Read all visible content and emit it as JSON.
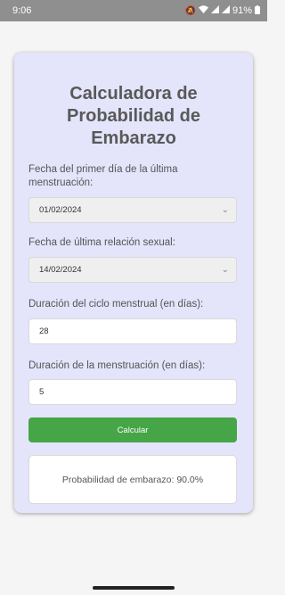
{
  "status_bar": {
    "time": "9:06",
    "battery": "91%",
    "icons": [
      "mute-icon",
      "wifi-icon",
      "signal-icon",
      "signal-icon",
      "battery-icon"
    ]
  },
  "app": {
    "title_line1": "Calculadora de",
    "title_line2": "Probabilidad de",
    "title_line3": "Embarazo",
    "last_period_label": "Fecha del primer día de la última menstruación:",
    "last_period_value": "01/02/2024",
    "last_intercourse_label": "Fecha de última relación sexual:",
    "last_intercourse_value": "14/02/2024",
    "cycle_label": "Duración del ciclo menstrual (en días):",
    "cycle_value": "28",
    "period_length_label": "Duración de la menstruación (en días):",
    "period_length_value": "5",
    "calculate_button": "Calcular",
    "result_text": "Probabilidad de embarazo: 90.0%"
  },
  "colors": {
    "card_background": "#e4e4fb",
    "button": "#45a547",
    "status_bar": "#8f8f8f"
  }
}
